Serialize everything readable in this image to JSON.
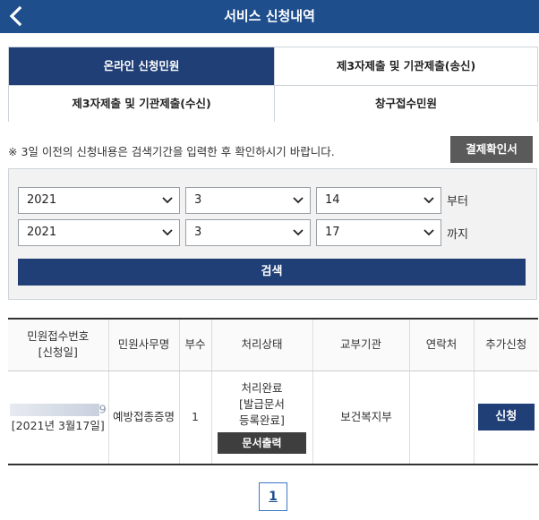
{
  "header": {
    "title": "서비스 신청내역",
    "back_icon": "chevron-left-icon"
  },
  "tabs": [
    {
      "label": "온라인 신청민원",
      "active": true
    },
    {
      "label": "제3자제출 및 기관제출(송신)",
      "active": false
    },
    {
      "label": "제3자제출 및 기관제출(수신)",
      "active": false
    },
    {
      "label": "창구접수민원",
      "active": false
    }
  ],
  "notice": "※ 3일 이전의 신청내용은 검색기간을 입력한 후 확인하시기 바랍니다.",
  "receipt_button": "결제확인서",
  "search": {
    "from": {
      "year": "2021",
      "month": "3",
      "day": "14",
      "suffix": "부터"
    },
    "to": {
      "year": "2021",
      "month": "3",
      "day": "17",
      "suffix": "까지"
    },
    "button": "검색"
  },
  "table": {
    "headers": {
      "receipt_no": "민원접수번호",
      "apply_date": "[신청일]",
      "name": "민원사무명",
      "copies": "부수",
      "status": "처리상태",
      "agency": "교부기관",
      "contact": "연락처",
      "extra": "추가신청"
    },
    "rows": [
      {
        "receipt_tail": "9",
        "date": "[2021년 3월17일]",
        "name": "예방접종증명",
        "copies": "1",
        "status_line1": "처리완료",
        "status_line2": "[발급문서",
        "status_line3": "등록완료]",
        "print_button": "문서출력",
        "agency": "보건복지부",
        "contact": "",
        "apply_button": "신청"
      }
    ]
  },
  "pagination": {
    "current": "1"
  },
  "colors": {
    "header": "#1f4e8c",
    "primary_button": "#1f3f76",
    "dark_button": "#3e3e3e"
  }
}
